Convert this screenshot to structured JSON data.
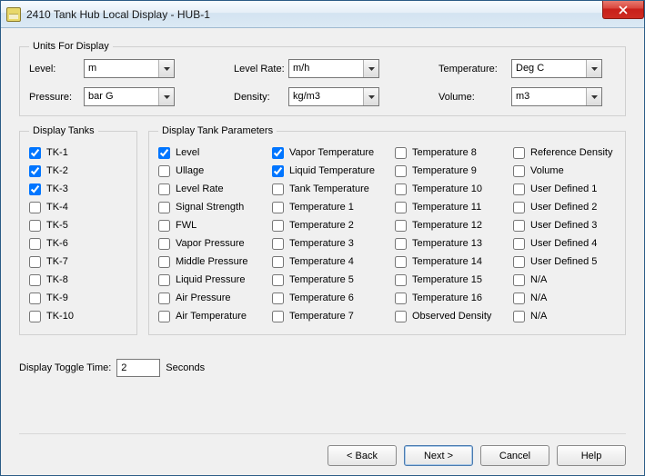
{
  "window": {
    "title": "2410 Tank Hub Local Display - HUB-1"
  },
  "units": {
    "legend": "Units For Display",
    "level_label": "Level:",
    "level_value": "m",
    "levelrate_label": "Level Rate:",
    "levelrate_value": "m/h",
    "temperature_label": "Temperature:",
    "temperature_value": "Deg C",
    "pressure_label": "Pressure:",
    "pressure_value": "bar G",
    "density_label": "Density:",
    "density_value": "kg/m3",
    "volume_label": "Volume:",
    "volume_value": "m3"
  },
  "tanks": {
    "legend": "Display Tanks",
    "items": [
      {
        "label": "TK-1",
        "checked": true
      },
      {
        "label": "TK-2",
        "checked": true
      },
      {
        "label": "TK-3",
        "checked": true
      },
      {
        "label": "TK-4",
        "checked": false
      },
      {
        "label": "TK-5",
        "checked": false
      },
      {
        "label": "TK-6",
        "checked": false
      },
      {
        "label": "TK-7",
        "checked": false
      },
      {
        "label": "TK-8",
        "checked": false
      },
      {
        "label": "TK-9",
        "checked": false
      },
      {
        "label": "TK-10",
        "checked": false
      }
    ]
  },
  "params": {
    "legend": "Display Tank Parameters",
    "col1": [
      {
        "label": "Level",
        "checked": true
      },
      {
        "label": "Ullage",
        "checked": false
      },
      {
        "label": "Level Rate",
        "checked": false
      },
      {
        "label": "Signal Strength",
        "checked": false
      },
      {
        "label": "FWL",
        "checked": false
      },
      {
        "label": "Vapor Pressure",
        "checked": false
      },
      {
        "label": "Middle Pressure",
        "checked": false
      },
      {
        "label": "Liquid Pressure",
        "checked": false
      },
      {
        "label": "Air Pressure",
        "checked": false
      },
      {
        "label": "Air Temperature",
        "checked": false
      }
    ],
    "col2": [
      {
        "label": "Vapor Temperature",
        "checked": true
      },
      {
        "label": "Liquid Temperature",
        "checked": true
      },
      {
        "label": "Tank Temperature",
        "checked": false
      },
      {
        "label": "Temperature 1",
        "checked": false
      },
      {
        "label": "Temperature 2",
        "checked": false
      },
      {
        "label": "Temperature 3",
        "checked": false
      },
      {
        "label": "Temperature 4",
        "checked": false
      },
      {
        "label": "Temperature 5",
        "checked": false
      },
      {
        "label": "Temperature 6",
        "checked": false
      },
      {
        "label": "Temperature 7",
        "checked": false
      }
    ],
    "col3": [
      {
        "label": "Temperature 8",
        "checked": false
      },
      {
        "label": "Temperature 9",
        "checked": false
      },
      {
        "label": "Temperature 10",
        "checked": false
      },
      {
        "label": "Temperature 11",
        "checked": false
      },
      {
        "label": "Temperature 12",
        "checked": false
      },
      {
        "label": "Temperature 13",
        "checked": false
      },
      {
        "label": "Temperature 14",
        "checked": false
      },
      {
        "label": "Temperature 15",
        "checked": false
      },
      {
        "label": "Temperature 16",
        "checked": false
      },
      {
        "label": "Observed Density",
        "checked": false
      }
    ],
    "col4": [
      {
        "label": "Reference Density",
        "checked": false
      },
      {
        "label": "Volume",
        "checked": false
      },
      {
        "label": "User Defined 1",
        "checked": false
      },
      {
        "label": "User Defined 2",
        "checked": false
      },
      {
        "label": "User Defined 3",
        "checked": false
      },
      {
        "label": "User Defined 4",
        "checked": false
      },
      {
        "label": "User Defined 5",
        "checked": false
      },
      {
        "label": "N/A",
        "checked": false
      },
      {
        "label": "N/A",
        "checked": false
      },
      {
        "label": "N/A",
        "checked": false
      }
    ]
  },
  "toggle": {
    "label": "Display Toggle Time:",
    "value": "2",
    "unit": "Seconds"
  },
  "buttons": {
    "back": "< Back",
    "next": "Next >",
    "cancel": "Cancel",
    "help": "Help"
  }
}
